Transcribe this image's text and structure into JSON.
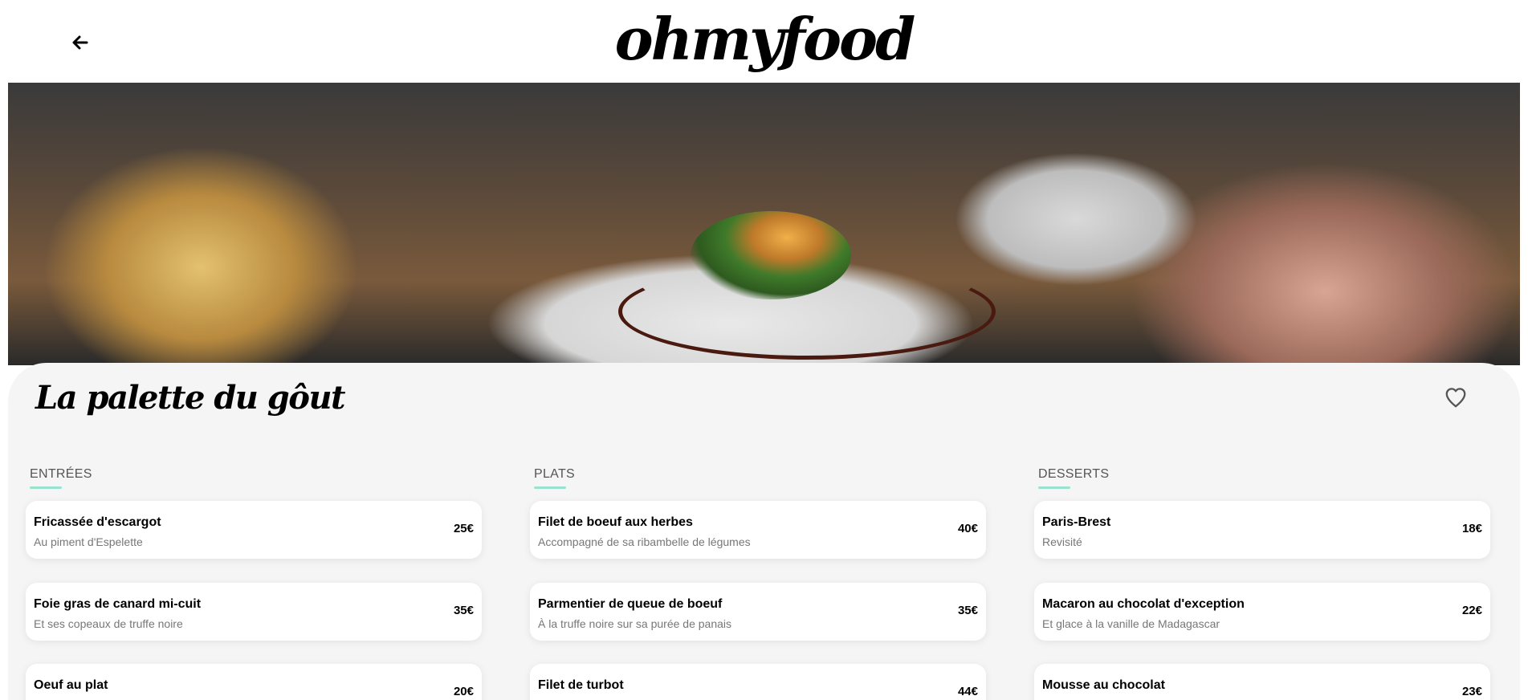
{
  "header": {
    "logo": "ohmyfood",
    "back_icon": "arrow-left-icon"
  },
  "restaurant": {
    "name": "La palette du gôut",
    "favorite_icon": "heart-outline-icon"
  },
  "menu": [
    {
      "title": "ENTRÉES",
      "items": [
        {
          "name": "Fricassée d'escargot",
          "desc": "Au piment d'Espelette",
          "price": "25€"
        },
        {
          "name": "Foie gras de canard mi-cuit",
          "desc": "Et ses copeaux de truffe noire",
          "price": "35€"
        },
        {
          "name": "Oeuf au plat",
          "desc": "",
          "price": "20€"
        }
      ]
    },
    {
      "title": "PLATS",
      "items": [
        {
          "name": "Filet de boeuf aux herbes",
          "desc": "Accompagné de sa ribambelle de légumes",
          "price": "40€"
        },
        {
          "name": "Parmentier de queue de boeuf",
          "desc": "À la truffe noire sur sa purée de panais",
          "price": "35€"
        },
        {
          "name": "Filet de turbot",
          "desc": "",
          "price": "44€"
        }
      ]
    },
    {
      "title": "DESSERTS",
      "items": [
        {
          "name": "Paris-Brest",
          "desc": "Revisité",
          "price": "18€"
        },
        {
          "name": "Macaron au chocolat d'exception",
          "desc": "Et glace à la vanille de Madagascar",
          "price": "22€"
        },
        {
          "name": "Mousse au chocolat",
          "desc": "",
          "price": "23€"
        }
      ]
    }
  ],
  "colors": {
    "accent": "#99e2d0",
    "panel_bg": "#f5f5f5"
  }
}
